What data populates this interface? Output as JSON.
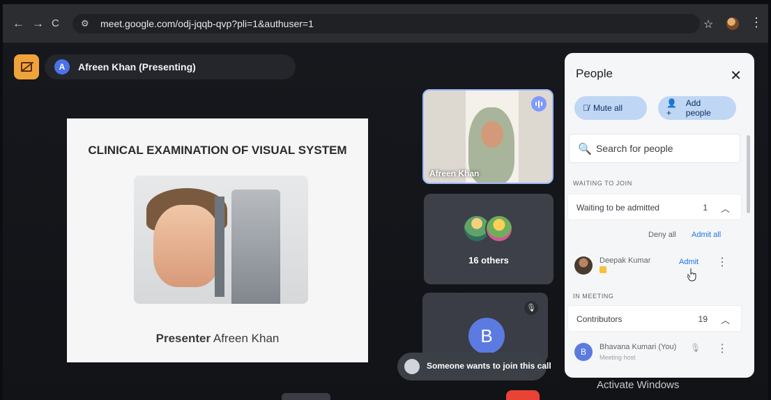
{
  "browser": {
    "back": "←",
    "forward": "→",
    "reload": "C",
    "url": "meet.google.com/odj-jqqb-qvp?pli=1&authuser=1"
  },
  "meet": {
    "presenting_initial": "A",
    "presenting_label": "Afreen Khan (Presenting)",
    "slide": {
      "title": "CLINICAL EXAMINATION OF VISUAL SYSTEM",
      "presenter_prefix": "Presenter",
      "presenter_name": "Afreen Khan"
    },
    "tiles": {
      "video_name": "Afreen Khan",
      "others_label": "16 others",
      "b_initial": "B"
    },
    "toast": "Someone wants to join this call"
  },
  "people": {
    "title": "People",
    "mute_all": "Mute all",
    "add_people": "Add people",
    "search_placeholder": "Search for people",
    "waiting_section": "WAITING TO JOIN",
    "waiting_group": {
      "label": "Waiting to be admitted",
      "count": "1"
    },
    "deny_all": "Deny all",
    "admit_all": "Admit all",
    "waiting_person": {
      "name": "Deepak Kumar",
      "action": "Admit"
    },
    "meeting_section": "IN MEETING",
    "contributors": {
      "label": "Contributors",
      "count": "19"
    },
    "host": {
      "initial": "B",
      "name": "Bhavana Kumari (You)",
      "role": "Meeting host"
    }
  },
  "os": {
    "watermark": "Activate Windows"
  },
  "colors": {
    "accent": "#1a73e8",
    "panel": "#f5f6f8",
    "leave": "#f0a33b",
    "end_call": "#ea4335"
  }
}
